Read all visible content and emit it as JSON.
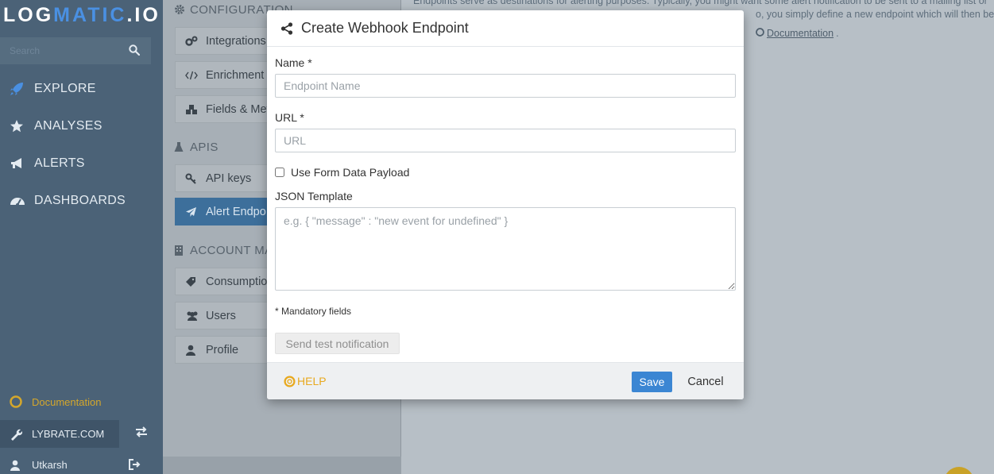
{
  "brand": {
    "logo_pre": "LOG",
    "logo_mid": "MATIC",
    "logo_post": ".IO"
  },
  "search": {
    "placeholder": "Search"
  },
  "nav": {
    "explore": "EXPLORE",
    "analyses": "ANALYSES",
    "alerts": "ALERTS",
    "dashboards": "DASHBOARDS"
  },
  "sidebar_footer": {
    "documentation": "Documentation",
    "account": "LYBRATE.COM",
    "user": "Utkarsh"
  },
  "settings": {
    "configuration": "CONFIGURATION",
    "integrations": "Integrations",
    "enrichment": "Enrichment",
    "fields": "Fields & Met",
    "apis": "APIS",
    "api_keys": "API keys",
    "alert_endpoints": "Alert Endpo",
    "account_management": "ACCOUNT MA",
    "consumption": "Consumption",
    "users": "Users",
    "profile": "Profile"
  },
  "intro": {
    "line1": "Endpoints serve as destinations for alerting purposes. Typically, you might want some alert notification to be sent to a mailing list or",
    "line2": "o, you simply define a new endpoint which will then be",
    "doc_link": "Documentation",
    "period": "."
  },
  "modal": {
    "title": "Create Webhook Endpoint",
    "name_label": "Name *",
    "name_placeholder": "Endpoint Name",
    "url_label": "URL *",
    "url_placeholder": "URL",
    "form_data_label": "Use Form Data Payload",
    "json_label": "JSON Template",
    "json_placeholder": "e.g. { \"message\" : \"new event for undefined\" }",
    "mandatory_note": "* Mandatory fields",
    "test_button": "Send test notification",
    "help": "HELP",
    "save": "Save",
    "cancel": "Cancel"
  },
  "colors": {
    "sidebar": "#4b6277",
    "accent": "#3b86d3",
    "help": "#e8a91f",
    "active_item": "#3d6f9b"
  }
}
